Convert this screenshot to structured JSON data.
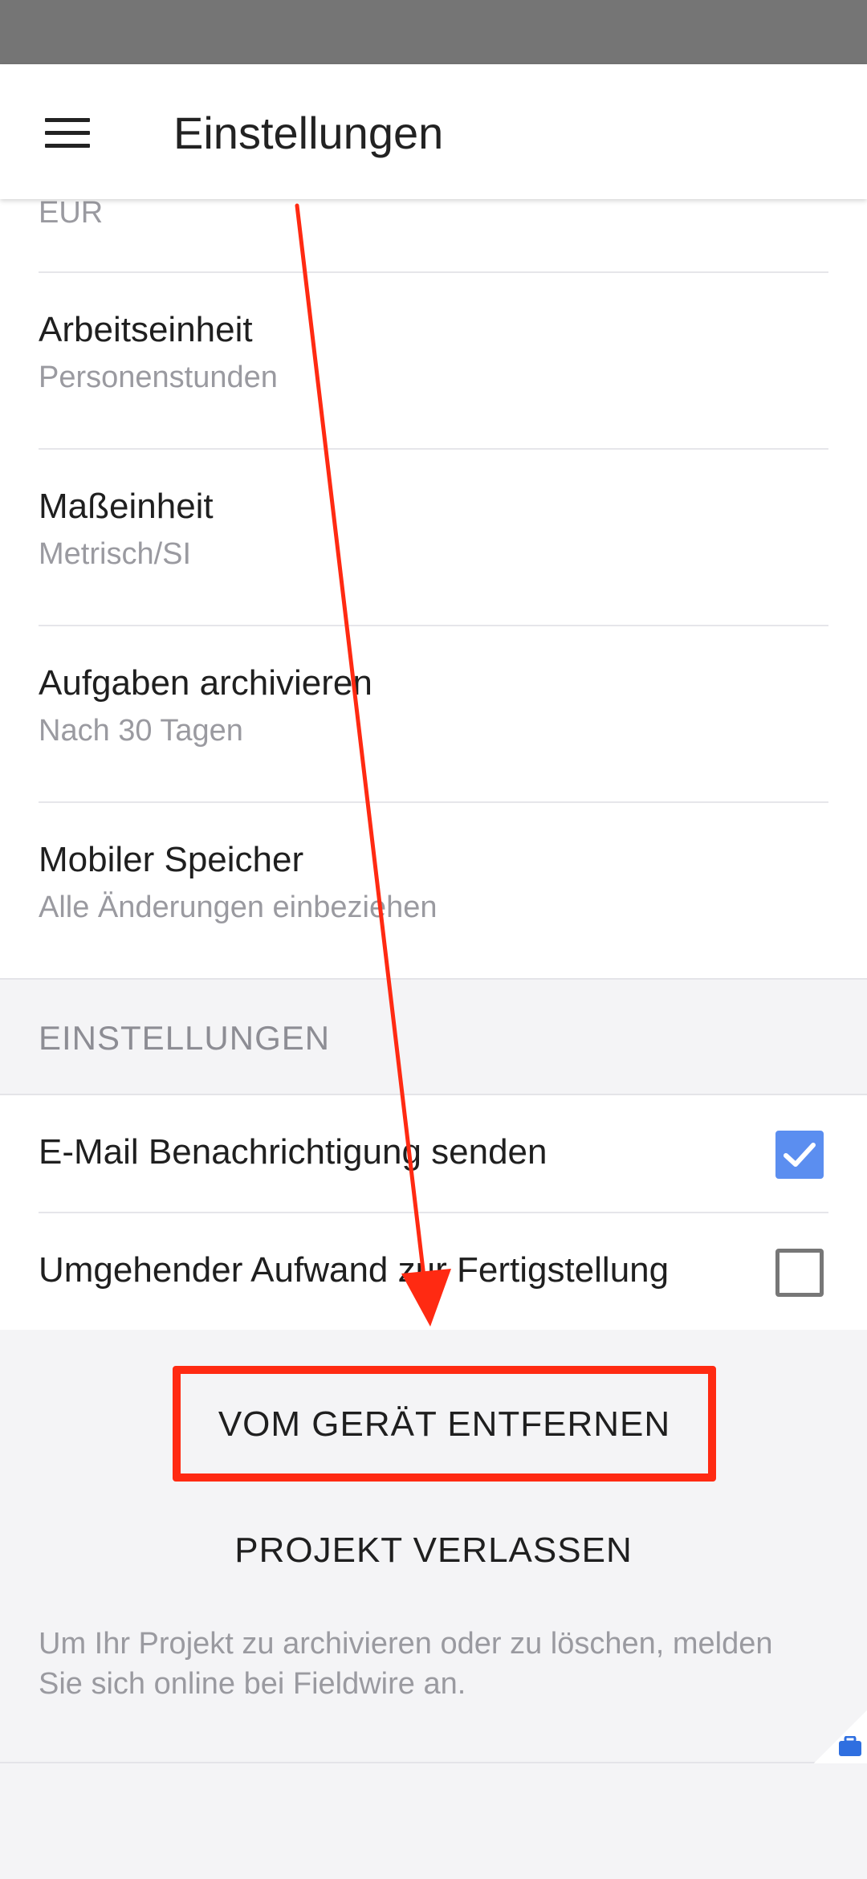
{
  "app_bar": {
    "title": "Einstellungen",
    "menu_icon": "hamburger-menu-icon"
  },
  "project_settings": {
    "currency_value": "EUR",
    "items": [
      {
        "label": "Arbeitseinheit",
        "value": "Personenstunden"
      },
      {
        "label": "Maßeinheit",
        "value": "Metrisch/SI"
      },
      {
        "label": "Aufgaben archivieren",
        "value": "Nach 30 Tagen"
      },
      {
        "label": "Mobiler Speicher",
        "value": "Alle Änderungen einbeziehen"
      }
    ]
  },
  "preferences": {
    "section_title": "EINSTELLUNGEN",
    "toggles": [
      {
        "label": "E-Mail Benachrichtigung senden",
        "checked": true
      },
      {
        "label": "Umgehender Aufwand zur Fertigstellung",
        "checked": false
      }
    ]
  },
  "actions": {
    "remove_label": "VOM GERÄT ENTFERNEN",
    "leave_label": "PROJEKT VERLASSEN",
    "info_text": "Um Ihr Projekt zu archivieren oder zu löschen, melden Sie sich online bei Fieldwire an."
  },
  "colors": {
    "status_bar": "#757575",
    "checkbox_checked": "#5b8ef0",
    "annotation_red": "#ff2a12",
    "briefcase_blue": "#2f6fe0"
  },
  "icons": {
    "checkbox_checked": "checkmark-icon",
    "corner_badge": "briefcase-icon"
  }
}
